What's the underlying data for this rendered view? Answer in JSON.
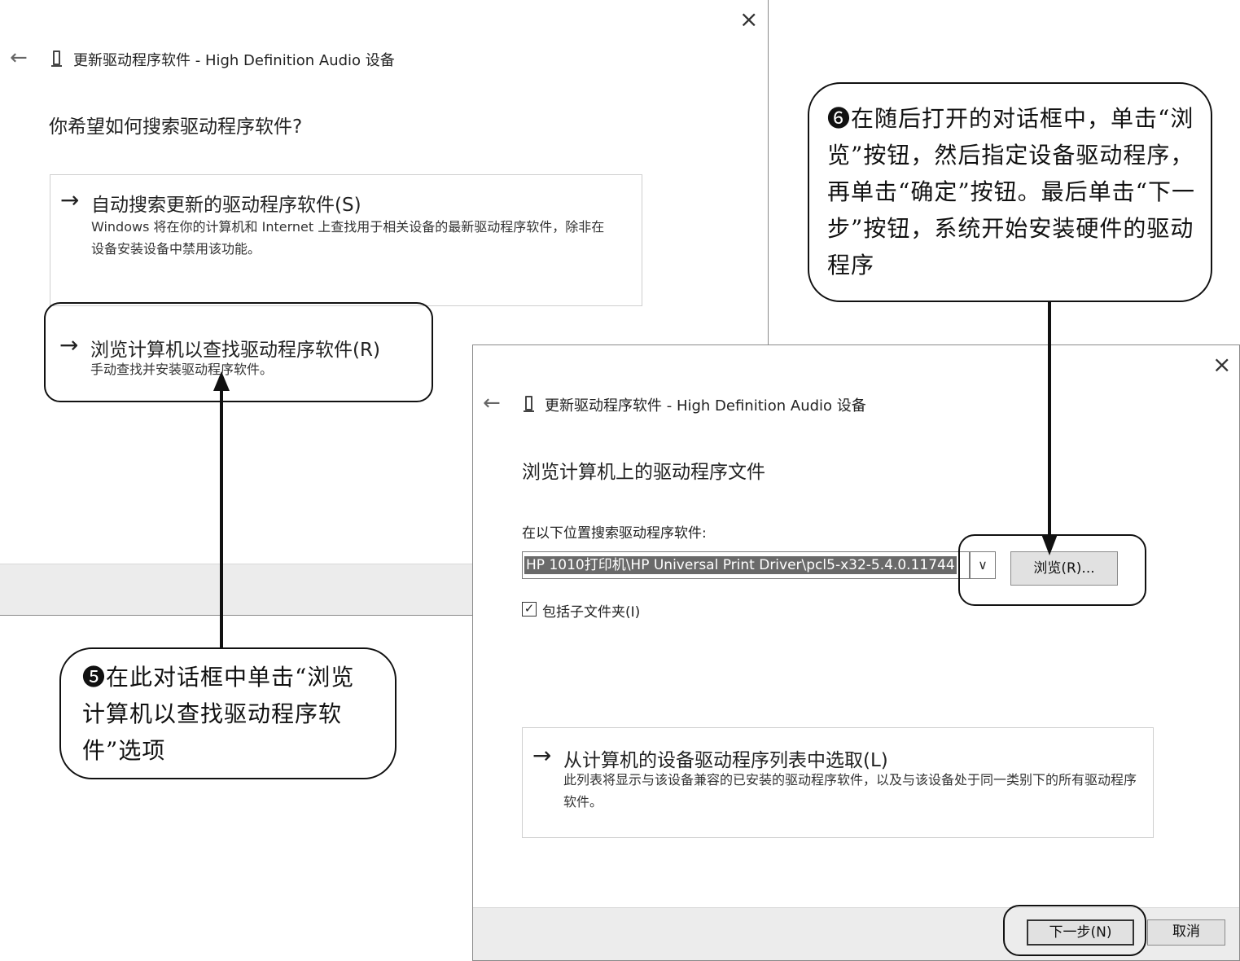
{
  "dialog1": {
    "header_title": "更新驱动程序软件 - High Definition Audio 设备",
    "heading": "你希望如何搜索驱动程序软件?",
    "option_auto": {
      "arrow": "→",
      "title": "自动搜索更新的驱动程序软件(S)",
      "desc": "Windows 将在你的计算机和 Internet 上查找用于相关设备的最新驱动程序软件，除非在设备安装设备中禁用该功能。"
    },
    "option_browse": {
      "arrow": "→",
      "title": "浏览计算机以查找驱动程序软件(R)",
      "desc": "手动查找并安装驱动程序软件。"
    },
    "close_glyph": "×",
    "back_glyph": "←"
  },
  "dialog2": {
    "header_title": "更新驱动程序软件 - High Definition Audio 设备",
    "heading": "浏览计算机上的驱动程序文件",
    "search_label": "在以下位置搜索驱动程序软件:",
    "path_value": "HP 1010打印机\\HP Universal Print Driver\\pcl5-x32-5.4.0.11744",
    "dropdown_glyph": "∨",
    "browse_button": "浏览(R)...",
    "include_subfolders": "包括子文件夹(I)",
    "checkbox_glyph": "✓",
    "option_list": {
      "arrow": "→",
      "title": "从计算机的设备驱动程序列表中选取(L)",
      "desc": "此列表将显示与该设备兼容的已安装的驱动程序软件，以及与该设备处于同一类别下的所有驱动程序软件。"
    },
    "next_button": "下一步(N)",
    "cancel_button": "取消",
    "close_glyph": "×",
    "back_glyph": "←"
  },
  "callout5": {
    "text": "❺在此对话框中单击“浏览计算机以查找驱动程序软件”选项"
  },
  "callout6": {
    "text": "❻在随后打开的对话框中，单击“浏览”按钮，然后指定设备驱动程序，再单击“确定”按钮。最后单击“下一步”按钮，系统开始安装硬件的驱动程序"
  },
  "icons": {
    "device": "device-icon",
    "back": "back-arrow-icon",
    "close": "close-icon"
  }
}
